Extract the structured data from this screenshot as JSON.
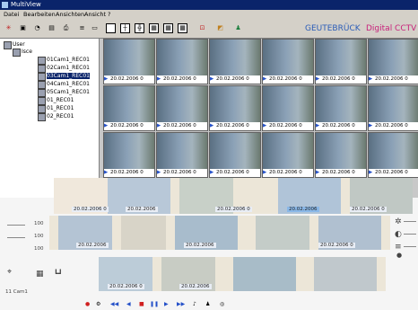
{
  "window": {
    "title": "MultiView"
  },
  "menu": [
    "Datei",
    "Bearbeiten",
    "Ansichten",
    "Ansicht",
    "?"
  ],
  "brand": {
    "logo": "GEUTEBRÜCK",
    "product": "Digital CCTV",
    "logo_color": "#2a5cb8",
    "product_color": "#c8207a"
  },
  "tree": {
    "items": [
      {
        "label": "User"
      },
      {
        "label": "Isce"
      },
      {
        "label": "01Cam1_REC01"
      },
      {
        "label": "02Cam1_REC01"
      },
      {
        "label": "03Cam1_REC01"
      },
      {
        "label": "04Cam1_REC01"
      },
      {
        "label": "05Cam1_REC01"
      },
      {
        "label": "01_REC01"
      },
      {
        "label": "01_REC01"
      },
      {
        "label": "02_REC01"
      }
    ]
  },
  "tiles": {
    "caption": "20.02.2006 0",
    "play_icon": "play-icon"
  },
  "lower": {
    "labels": [
      "20.02.2006 0",
      "20.02.2006",
      "20.02.2006 0",
      "20.02.2006",
      "20.02.2006 0",
      "20.02.2006"
    ],
    "side_values": [
      "100",
      "100",
      "100"
    ],
    "counter": "11 Cam1"
  },
  "colors": {
    "titlebar": "#0a246a",
    "window_bg": "#d4d0c8",
    "selection": "#0a246a",
    "play": "#2450c8",
    "record": "#d02020"
  }
}
